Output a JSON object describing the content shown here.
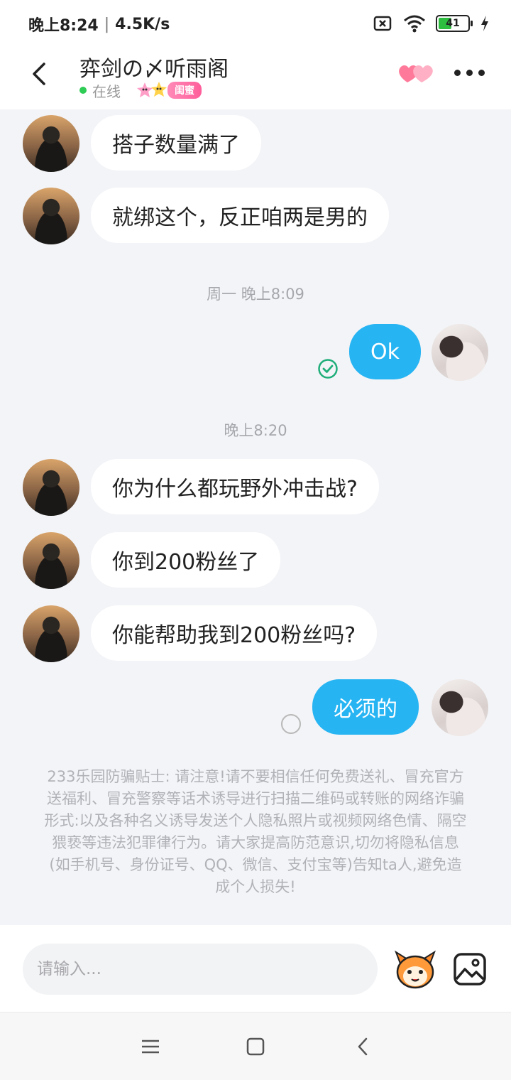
{
  "status_bar": {
    "time": "晚上8:24",
    "speed": "4.5K/s",
    "battery": "41"
  },
  "header": {
    "title": "弈剑の〆听雨阁",
    "online_status": "在线",
    "relation_badge": "闺蜜"
  },
  "messages": [
    {
      "side": "in",
      "text": "搭子数量满了"
    },
    {
      "side": "in",
      "text": "就绑这个，反正咱两是男的"
    },
    {
      "type": "time",
      "text": "周一 晚上8:09"
    },
    {
      "side": "out",
      "text": "Ok",
      "status": "read"
    },
    {
      "type": "time",
      "text": "晚上8:20"
    },
    {
      "side": "in",
      "text": "你为什么都玩野外冲击战?"
    },
    {
      "side": "in",
      "text": "你到200粉丝了"
    },
    {
      "side": "in",
      "text": "你能帮助我到200粉丝吗?"
    },
    {
      "side": "out",
      "text": "必须的",
      "status": "sending"
    }
  ],
  "notice": "233乐园防骗贴士: 请注意!请不要相信任何免费送礼、冒充官方送福利、冒充警察等话术诱导进行扫描二维码或转账的网络诈骗形式:以及各种名义诱导发送个人隐私照片或视频网络色情、隔空猥亵等违法犯罪律行为。请大家提高防范意识,切勿将隐私信息(如手机号、身份证号、QQ、微信、支付宝等)告知ta人,避免造成个人损失!",
  "input": {
    "placeholder": "请输入..."
  },
  "colors": {
    "outgoing_bubble": "#26b4f3",
    "incoming_bubble": "#ffffff",
    "background": "#f3f4f7",
    "online_dot": "#2ecc55"
  }
}
